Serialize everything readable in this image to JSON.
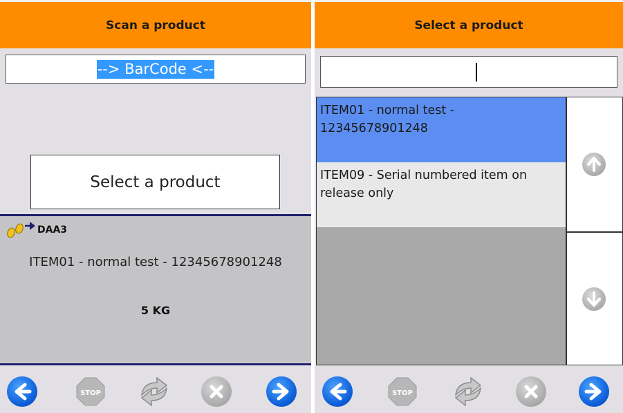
{
  "left": {
    "header_title": "Scan a product",
    "barcode_value": "--> BarCode <--",
    "select_button_label": "Select a product",
    "location_code": "DAA3",
    "product_description": "ITEM01 - normal test - 12345678901248",
    "product_quantity": "5 KG"
  },
  "right": {
    "header_title": "Select a product",
    "search_value": "",
    "list_items": [
      {
        "label": "ITEM01 - normal test - 12345678901248",
        "selected": true
      },
      {
        "label": "ITEM09 - Serial numbered item on release only",
        "selected": false
      }
    ]
  },
  "toolbar": {
    "stop_label": "STOP",
    "icons": [
      "back-arrow-icon",
      "stop-icon",
      "refresh-icon",
      "cancel-icon",
      "forward-arrow-icon"
    ]
  },
  "colors": {
    "header": "#ff8c00",
    "selection": "#5b8ef0",
    "nav_blue": "#0d5fd9",
    "divider": "#1e1e6e"
  }
}
